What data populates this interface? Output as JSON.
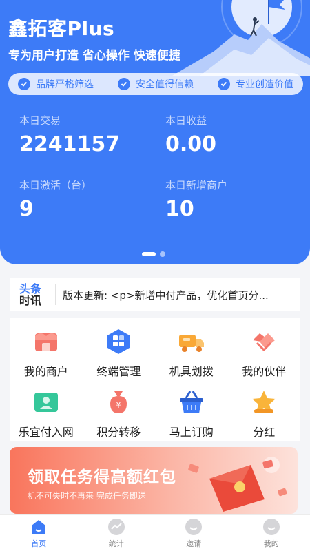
{
  "header": {
    "brand": "鑫拓客Plus",
    "slogan": "专为用户打造 省心操作 快速便捷",
    "badges": [
      "品牌严格筛选",
      "安全值得信赖",
      "专业创造价值"
    ]
  },
  "stats": [
    {
      "label": "本日交易",
      "value": "2241157"
    },
    {
      "label": "本日收益",
      "value": "0.00"
    },
    {
      "label": "本日激活（台）",
      "value": "9"
    },
    {
      "label": "本日新增商户",
      "value": "10"
    }
  ],
  "news": {
    "logo_top": "头条",
    "logo_bottom": "时讯",
    "text": "版本更新: <p>新增中付产品，优化首页分..."
  },
  "menu": [
    {
      "label": "我的商户",
      "icon": "merchant-icon"
    },
    {
      "label": "终端管理",
      "icon": "terminal-management-icon"
    },
    {
      "label": "机具划拨",
      "icon": "device-transfer-icon"
    },
    {
      "label": "我的伙伴",
      "icon": "partner-handshake-icon"
    },
    {
      "label": "乐宜付入网",
      "icon": "network-join-icon"
    },
    {
      "label": "积分转移",
      "icon": "points-transfer-icon"
    },
    {
      "label": "马上订购",
      "icon": "shopping-basket-icon"
    },
    {
      "label": "分红",
      "icon": "dividend-star-icon"
    }
  ],
  "banner": {
    "title": "领取任务得高额红包",
    "subtitle": "机不可失时不再来 完成任务即送"
  },
  "tabbar": [
    {
      "label": "首页",
      "icon": "home-icon",
      "active": true
    },
    {
      "label": "统计",
      "icon": "statistics-icon",
      "active": false
    },
    {
      "label": "邀请",
      "icon": "invite-icon",
      "active": false
    },
    {
      "label": "我的",
      "icon": "profile-icon",
      "active": false
    }
  ],
  "colors": {
    "primary": "#3d7bf7",
    "banner_start": "#f9755c"
  }
}
